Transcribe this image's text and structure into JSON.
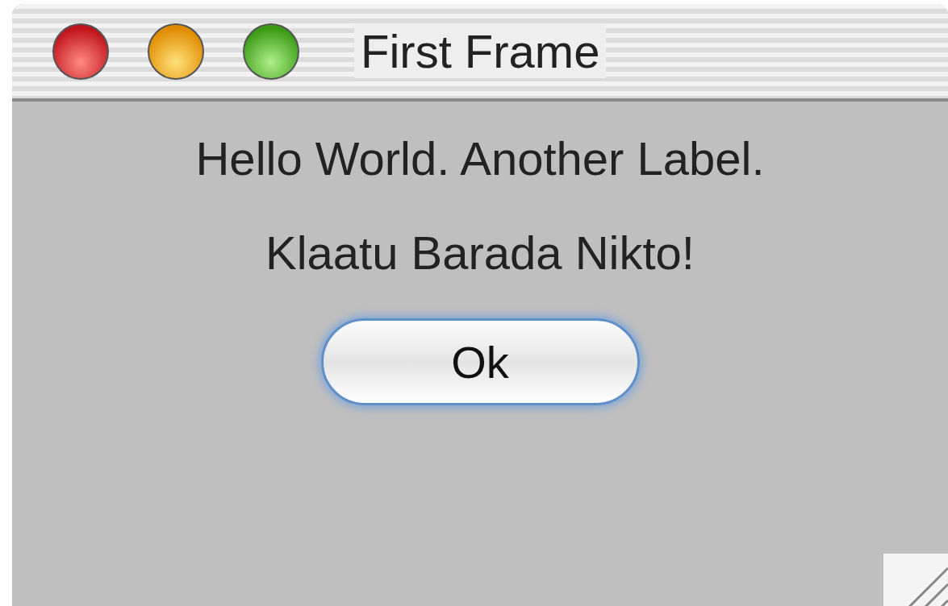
{
  "window": {
    "title": "First Frame",
    "controls": [
      {
        "kind": "close"
      },
      {
        "kind": "minimize"
      },
      {
        "kind": "zoom"
      }
    ]
  },
  "labels": [
    "Hello World. Another Label.",
    "Klaatu Barada Nikto!"
  ],
  "button": {
    "label": "Ok",
    "default": true
  }
}
